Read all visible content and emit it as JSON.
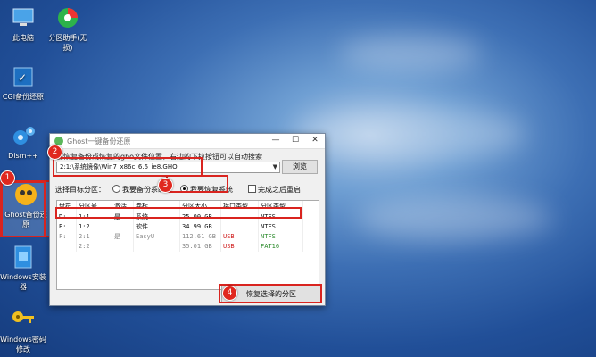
{
  "desktop": {
    "icons": [
      {
        "label": "此电脑"
      },
      {
        "label": "分区助手(无损)"
      },
      {
        "label": "CGI备份还原"
      },
      {
        "label": "Dism++"
      },
      {
        "label": "Ghost备份还原"
      },
      {
        "label": "Windows安装器"
      },
      {
        "label": "Windows密码修改"
      }
    ]
  },
  "window": {
    "title": "Ghost一键备份还原",
    "minimize": "—",
    "maximize": "☐",
    "close": "✕",
    "instruction": "要恢复备份或恢复的gho文件位置，右边的下拉按钮可以自动搜索",
    "path_value": "2:1:\\系统镜像\\Win7_x86c_6.6_ie8.GHO",
    "browse_label": "浏览",
    "target_label": "选择目标分区：",
    "radio_backup": "我要备份系统",
    "radio_restore": "我要恢复系统",
    "check_shutdown": "完成之后重启",
    "restore_button": "恢复选择的分区"
  },
  "table": {
    "headers": [
      "盘符",
      "分区号",
      "激活",
      "卷标",
      "分区大小",
      "接口类型",
      "分区类型"
    ],
    "rows": [
      [
        "D:",
        "1:1",
        "是",
        "系统",
        "25.00 GB",
        "",
        "NTFS"
      ],
      [
        "E:",
        "1:2",
        "",
        "软件",
        "34.99 GB",
        "",
        "NTFS"
      ],
      [
        "F:",
        "2:1",
        "是",
        "EasyU",
        "112.61 GB",
        "USB",
        "NTFS"
      ],
      [
        "",
        "2:2",
        "",
        "",
        "35.01 GB",
        "USB",
        "FAT16"
      ]
    ]
  },
  "badges": [
    "1",
    "2",
    "3",
    "4"
  ],
  "colors": {
    "highlight": "#d9241f",
    "badge": "#e0281f"
  }
}
